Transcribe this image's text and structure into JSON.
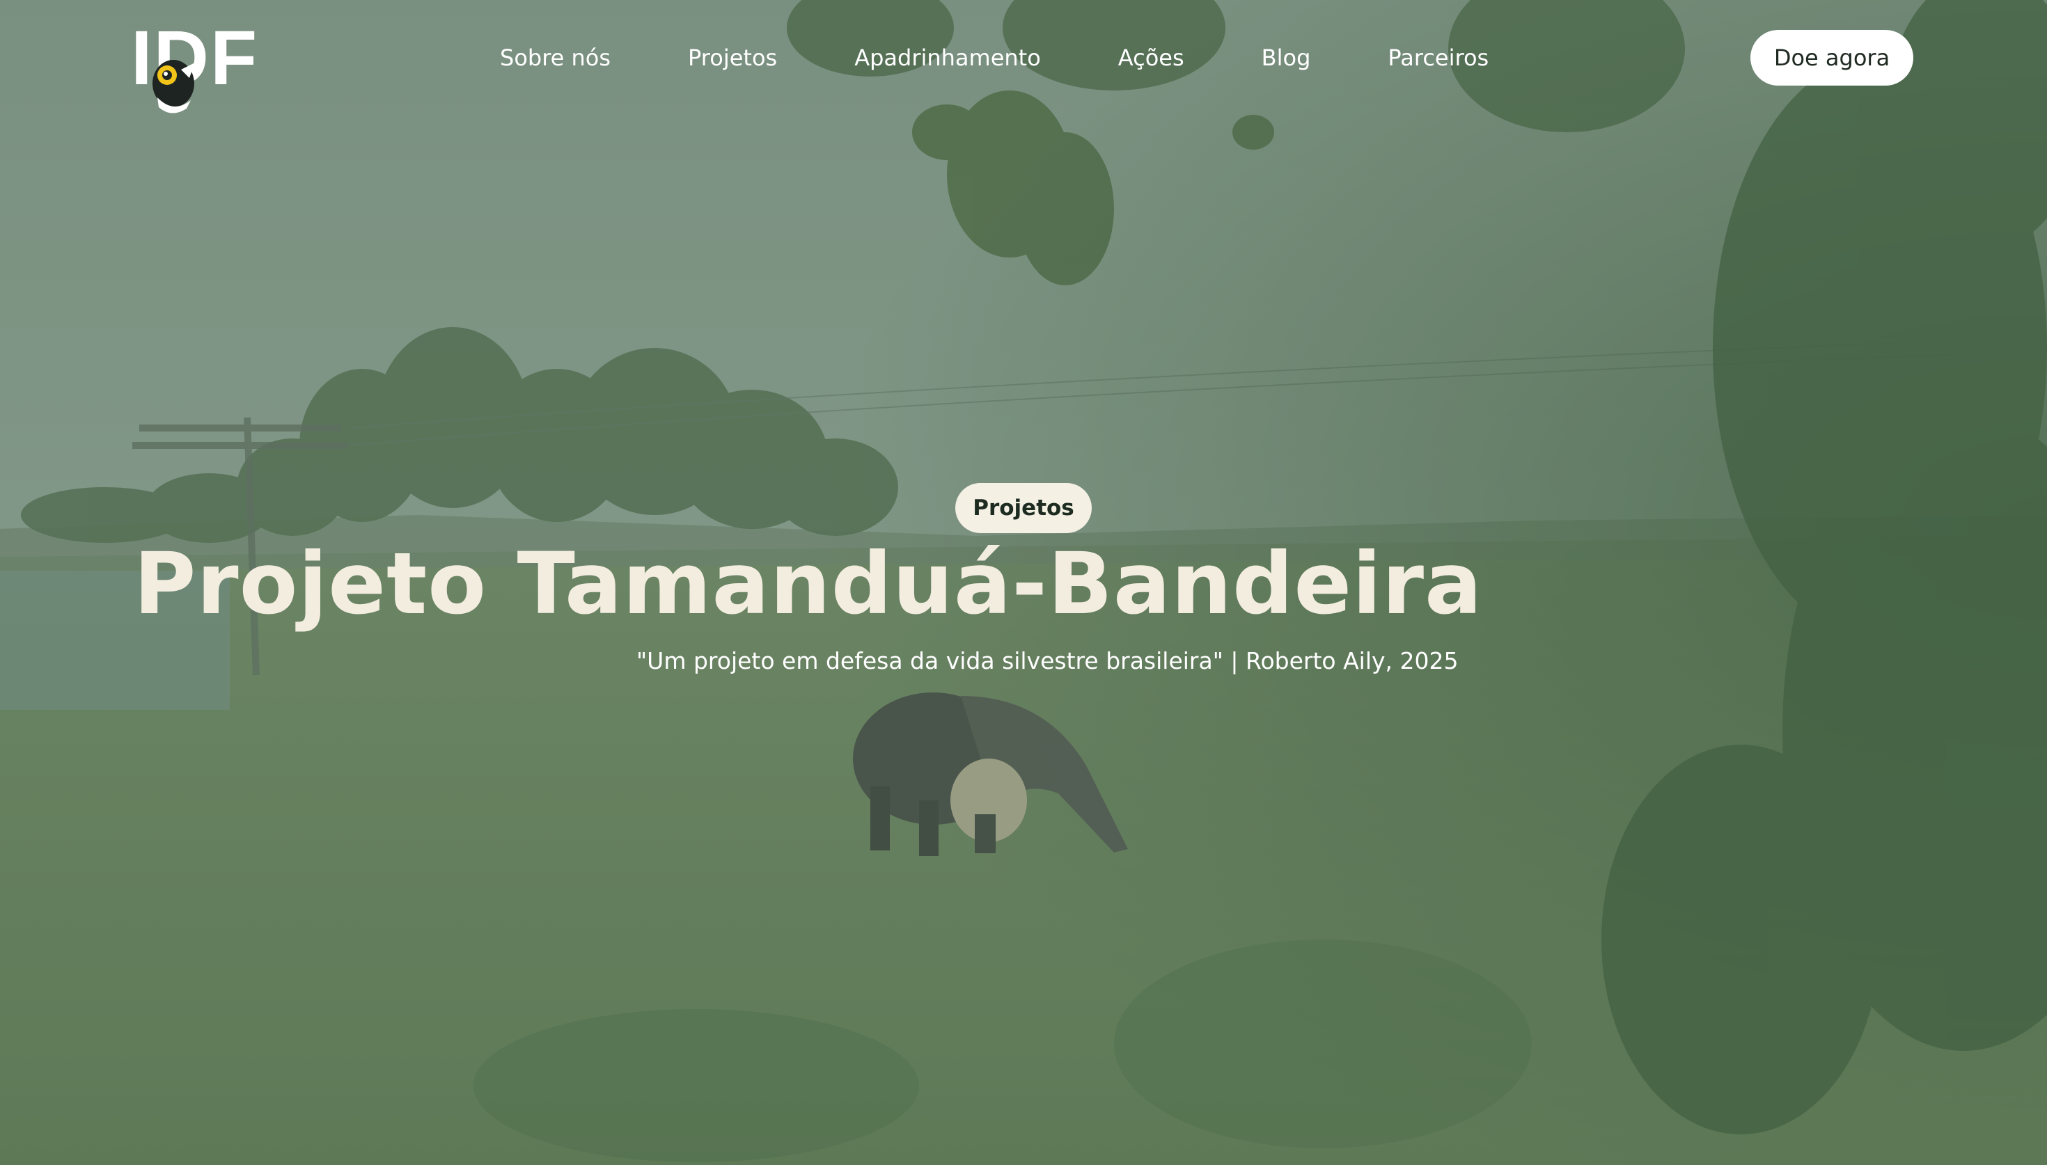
{
  "header": {
    "logo_text": "IDF",
    "nav": [
      {
        "label": "Sobre nós"
      },
      {
        "label": "Projetos"
      },
      {
        "label": "Apadrinhamento"
      },
      {
        "label": "Ações"
      },
      {
        "label": "Blog"
      },
      {
        "label": "Parceiros"
      }
    ],
    "donate_label": "Doe agora"
  },
  "hero": {
    "badge": "Projetos",
    "title": "Projeto Tamanduá-Bandeira",
    "quote": "\"Um projeto em defesa da vida silvestre brasileira\" | Roberto Aily, 2025"
  },
  "colors": {
    "overlay": "#7f9684",
    "grass": "#5d7a54",
    "title_text": "#f3ede0",
    "button_bg": "#ffffff",
    "badge_bg": "#f4f0e4"
  }
}
